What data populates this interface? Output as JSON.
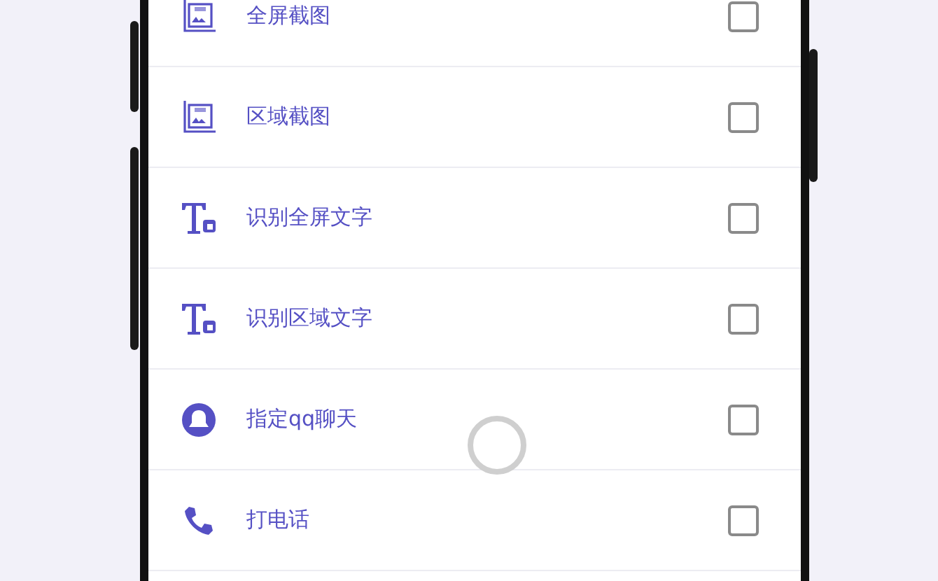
{
  "options": [
    {
      "kind": "screenshot",
      "label": "全屏截图",
      "checked": false
    },
    {
      "kind": "screenshot",
      "label": "区域截图",
      "checked": false
    },
    {
      "kind": "ocr",
      "label": "识别全屏文字",
      "checked": false
    },
    {
      "kind": "ocr",
      "label": "识别区域文字",
      "checked": false
    },
    {
      "kind": "chat",
      "label": "指定qq聊天",
      "checked": false
    },
    {
      "kind": "call",
      "label": "打电话",
      "checked": false
    }
  ]
}
